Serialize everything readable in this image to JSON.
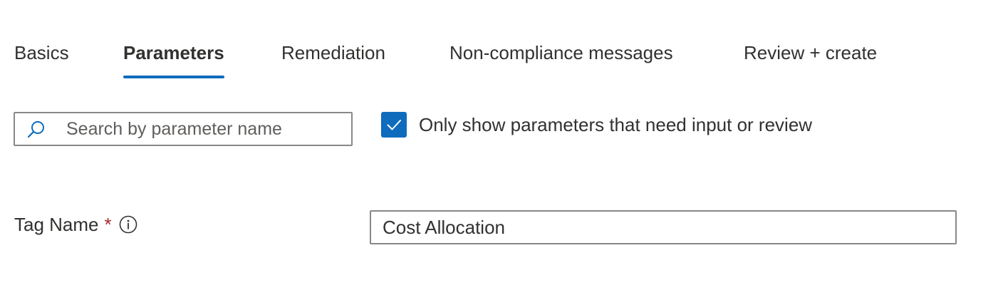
{
  "tabs": [
    {
      "label": "Basics",
      "active": false
    },
    {
      "label": "Parameters",
      "active": true
    },
    {
      "label": "Remediation",
      "active": false
    },
    {
      "label": "Non-compliance messages",
      "active": false
    },
    {
      "label": "Review + create",
      "active": false
    }
  ],
  "search": {
    "placeholder": "Search by parameter name",
    "value": "",
    "icon": "search-icon"
  },
  "filter": {
    "checked": true,
    "label": "Only show parameters that need input or review"
  },
  "parameters": [
    {
      "label": "Tag Name",
      "required_marker": "*",
      "info_icon": "info-icon",
      "value": "Cost Allocation"
    }
  ],
  "colors": {
    "accent": "#0f6cbd",
    "text": "#323130",
    "border": "#8a8886",
    "required": "#a4262c"
  }
}
